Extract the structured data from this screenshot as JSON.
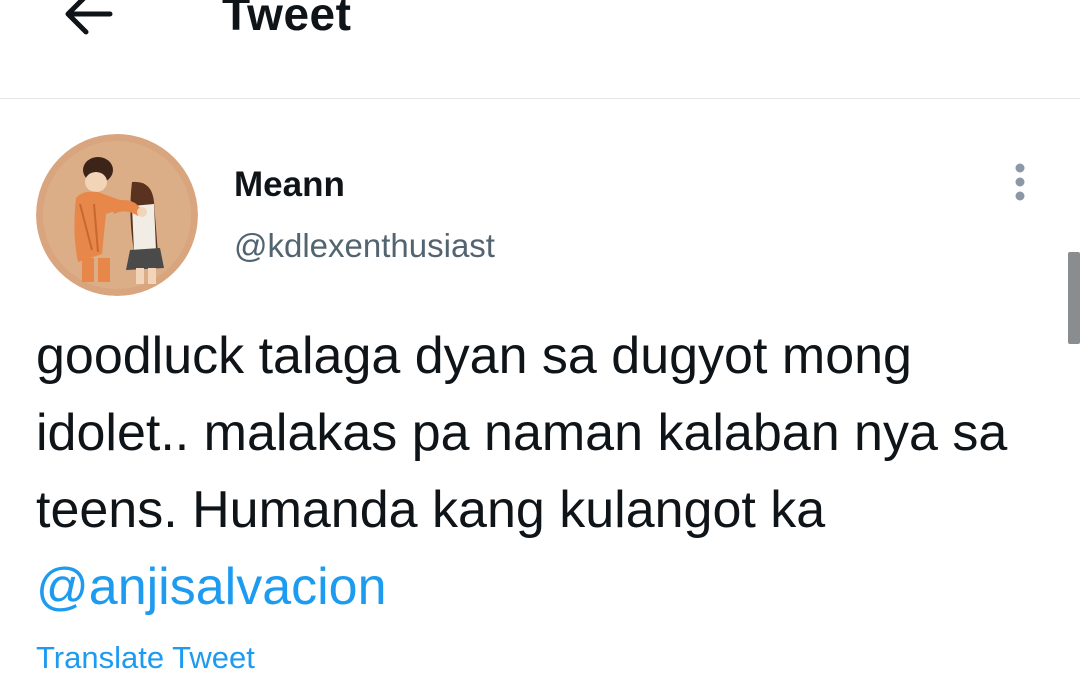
{
  "header": {
    "title": "Tweet",
    "back_icon": "arrow-left-icon"
  },
  "tweet": {
    "author": {
      "display_name": "Meann",
      "handle": "@kdlexenthusiast",
      "avatar": "avatar-illustration"
    },
    "more_icon": "more-vertical-icon",
    "text_before_mention": "goodluck talaga dyan sa dugyot mong idolet.. malakas pa naman kalaban nya sa teens. Humanda kang kulangot ka ",
    "mention": "@anjisalvacion",
    "translate_label": "Translate Tweet"
  },
  "colors": {
    "accent": "#1d9bf0",
    "text_primary": "#0f1419",
    "text_secondary": "#536471",
    "divider": "#e3e6e8"
  }
}
